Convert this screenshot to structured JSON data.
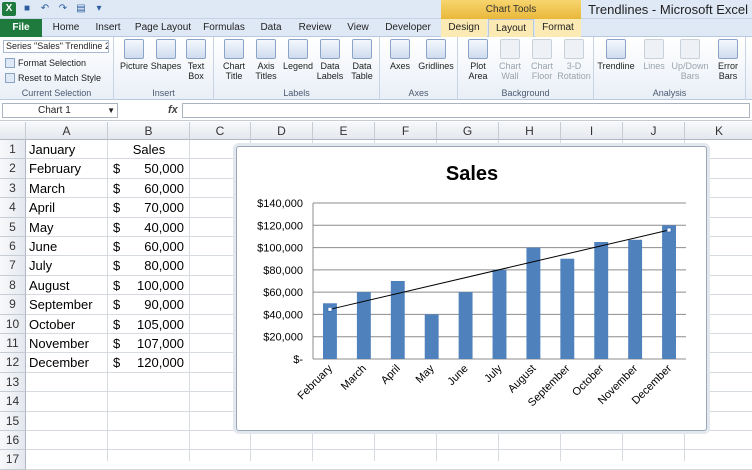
{
  "window": {
    "title": "Trendlines - Microsoft Excel"
  },
  "chart_tools": {
    "label": "Chart Tools"
  },
  "tabs": [
    "File",
    "Home",
    "Insert",
    "Page Layout",
    "Formulas",
    "Data",
    "Review",
    "View",
    "Developer",
    "Design",
    "Layout",
    "Format"
  ],
  "ribbon": {
    "current_selection": {
      "selector": "Series \"Sales\" Trendline 2",
      "format_selection": "Format Selection",
      "reset": "Reset to Match Style",
      "label": "Current Selection"
    },
    "insert": {
      "label": "Insert",
      "buttons": [
        "Picture",
        "Shapes",
        "Text Box"
      ]
    },
    "labels": {
      "label": "Labels",
      "buttons": [
        "Chart Title",
        "Axis Titles",
        "Legend",
        "Data Labels",
        "Data Table"
      ]
    },
    "axes": {
      "label": "Axes",
      "buttons": [
        "Axes",
        "Gridlines"
      ]
    },
    "background": {
      "label": "Background",
      "buttons": [
        "Plot Area",
        "Chart Wall",
        "Chart Floor",
        "3-D Rotation"
      ]
    },
    "analysis": {
      "label": "Analysis",
      "buttons": [
        "Trendline",
        "Lines",
        "Up/Down Bars",
        "Error Bars"
      ]
    }
  },
  "formula_bar": {
    "name_box": "Chart 1",
    "fx": "fx",
    "value": ""
  },
  "sheet": {
    "columns": [
      "A",
      "B",
      "C",
      "D",
      "E",
      "F",
      "G",
      "H",
      "I",
      "J",
      "K"
    ],
    "rows": [
      "1",
      "2",
      "3",
      "4",
      "5",
      "6",
      "7",
      "8",
      "9",
      "10",
      "11",
      "12",
      "13",
      "14",
      "15",
      "16",
      "17"
    ],
    "header_a": "January",
    "header_b": "Sales",
    "currency": "$",
    "data": [
      [
        "February",
        "50,000"
      ],
      [
        "March",
        "60,000"
      ],
      [
        "April",
        "70,000"
      ],
      [
        "May",
        "40,000"
      ],
      [
        "June",
        "60,000"
      ],
      [
        "July",
        "80,000"
      ],
      [
        "August",
        "100,000"
      ],
      [
        "September",
        "90,000"
      ],
      [
        "October",
        "105,000"
      ],
      [
        "November",
        "107,000"
      ],
      [
        "December",
        "120,000"
      ]
    ]
  },
  "chart_data": {
    "type": "bar",
    "title": "Sales",
    "categories": [
      "February",
      "March",
      "April",
      "May",
      "June",
      "July",
      "August",
      "September",
      "October",
      "November",
      "December"
    ],
    "values": [
      50000,
      60000,
      70000,
      40000,
      60000,
      80000,
      100000,
      90000,
      105000,
      107000,
      120000
    ],
    "ylim": [
      0,
      140000
    ],
    "yticks": [
      "$-",
      "$20,000",
      "$40,000",
      "$60,000",
      "$80,000",
      "$100,000",
      "$120,000",
      "$140,000"
    ],
    "trendline": "linear",
    "grid": true,
    "legend": "none",
    "colors": {
      "bar": "#4f81bd",
      "trendline": "#000000"
    }
  }
}
